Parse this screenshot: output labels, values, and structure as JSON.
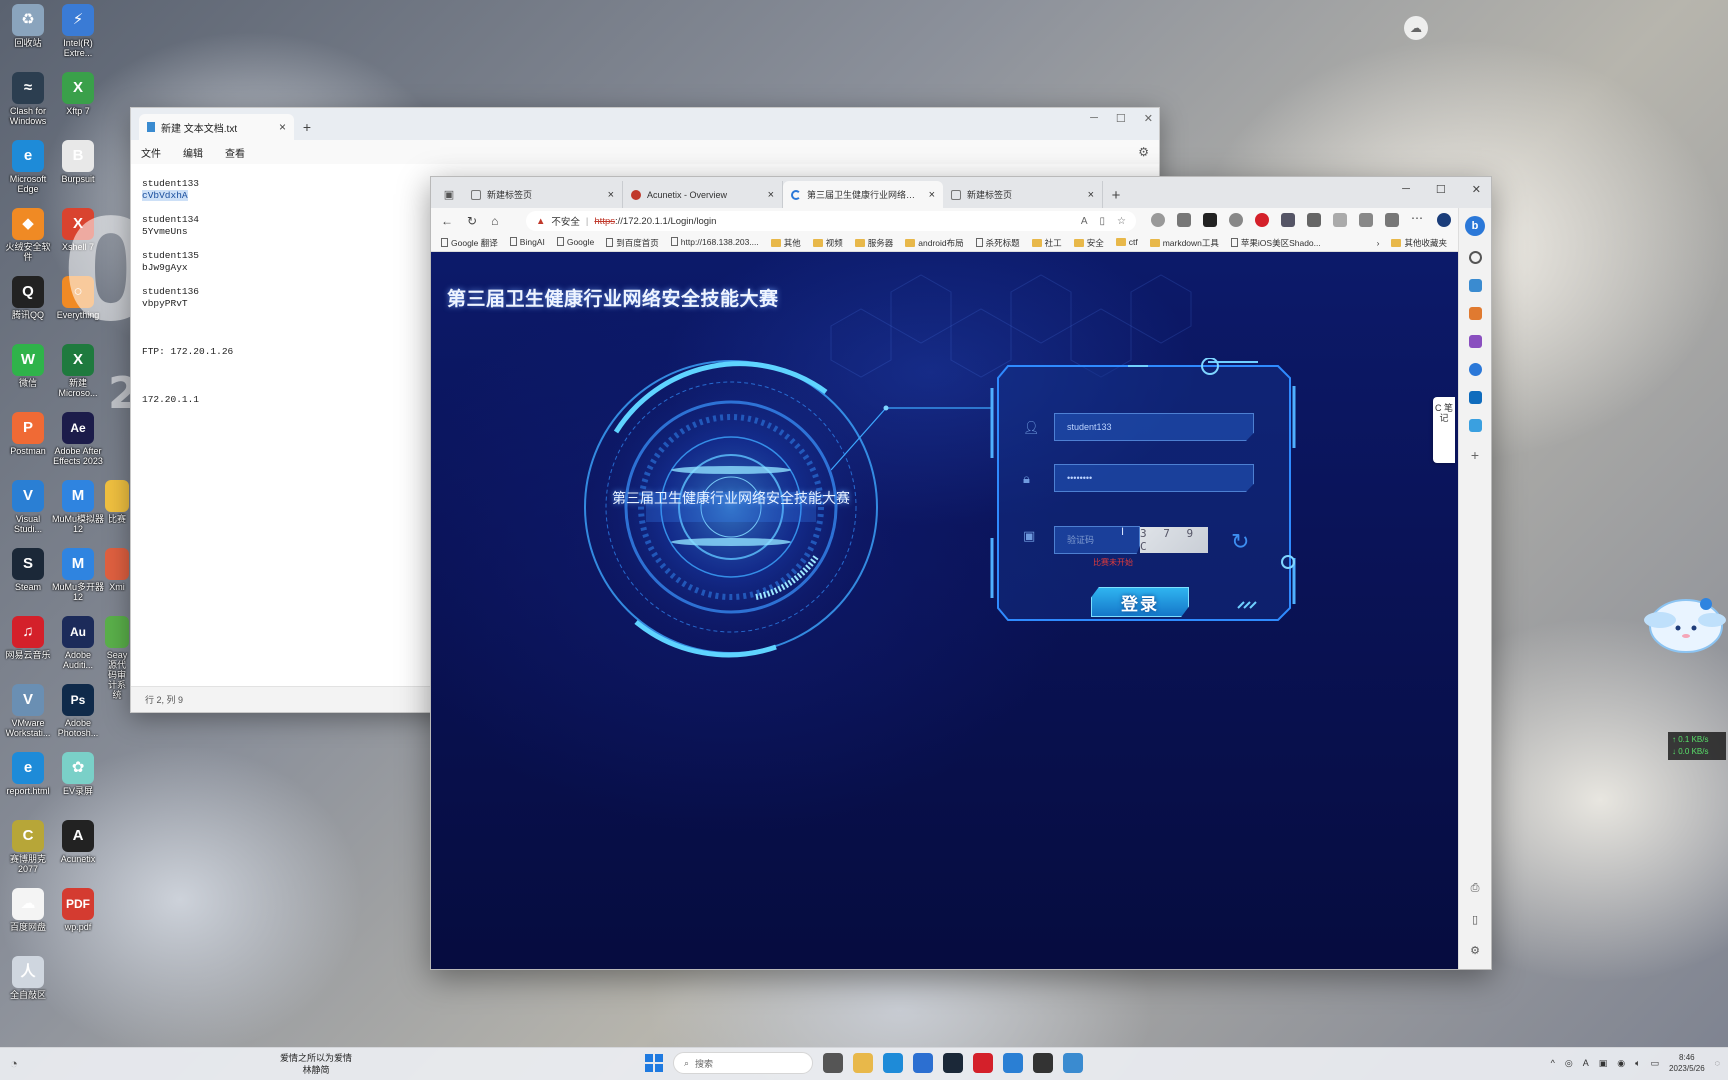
{
  "desktop": {
    "icons": [
      {
        "label": "回收站",
        "color": "#8aa4bd",
        "glyph": "♻"
      },
      {
        "label": "Intel(R) Extre...",
        "color": "#3a7bd5",
        "glyph": "⚡"
      },
      {
        "label": "Clash for Windows",
        "color": "#2c3e50",
        "glyph": "≈"
      },
      {
        "label": "Xftp 7",
        "color": "#3aa04a",
        "glyph": "X"
      },
      {
        "label": "Microsoft Edge",
        "color": "#1e8bd8",
        "glyph": "e"
      },
      {
        "label": "Burpsuit",
        "color": "#e8e8e8",
        "glyph": "B"
      },
      {
        "label": "火绒安全软件",
        "color": "#f08a24",
        "glyph": "◆"
      },
      {
        "label": "Xshell 7",
        "color": "#d9432f",
        "glyph": "X"
      },
      {
        "label": "腾讯QQ",
        "color": "#222",
        "glyph": "Q"
      },
      {
        "label": "Everything",
        "color": "#f08a24",
        "glyph": "○"
      },
      {
        "label": "微信",
        "color": "#2fb34a",
        "glyph": "W"
      },
      {
        "label": "新建 Microso...",
        "color": "#1f7a3e",
        "glyph": "X"
      },
      {
        "label": "Postman",
        "color": "#f06a35",
        "glyph": "P"
      },
      {
        "label": "Adobe After Effects 2023",
        "color": "#1c1c4a",
        "glyph": "Ae"
      },
      {
        "label": "Visual Studi...",
        "color": "#2a7fd4",
        "glyph": "V"
      },
      {
        "label": "MuMu模拟器12",
        "color": "#2f84e0",
        "glyph": "M"
      },
      {
        "label": "Steam",
        "color": "#1b2838",
        "glyph": "S"
      },
      {
        "label": "MuMu多开器12",
        "color": "#2f84e0",
        "glyph": "M"
      },
      {
        "label": "网易云音乐",
        "color": "#d4202a",
        "glyph": "♫"
      },
      {
        "label": "Adobe Auditi...",
        "color": "#1c2b5a",
        "glyph": "Au"
      },
      {
        "label": "VMware Workstati...",
        "color": "#6a8fb3",
        "glyph": "V"
      },
      {
        "label": "Adobe Photosh...",
        "color": "#0f2a4a",
        "glyph": "Ps"
      },
      {
        "label": "report.html",
        "color": "#1e8bd8",
        "glyph": "e"
      },
      {
        "label": "EV录屏",
        "color": "#7ad0c8",
        "glyph": "✿"
      },
      {
        "label": "赛博朋克 2077",
        "color": "#b7a638",
        "glyph": "C"
      },
      {
        "label": "Acunetix",
        "color": "#222",
        "glyph": "A"
      },
      {
        "label": "百度网盘",
        "color": "#f4f4f4",
        "glyph": "☁"
      },
      {
        "label": "wp.pdf",
        "color": "#d43b30",
        "glyph": "PDF"
      },
      {
        "label": "全自敲区",
        "color": "#cfd6df",
        "glyph": "人"
      }
    ],
    "partial_icons": [
      {
        "label": "比赛",
        "color": "#f0c040"
      },
      {
        "label": "Xmi",
        "color": "#e06040"
      },
      {
        "label": "Seay源代码审计系统",
        "color": "#5ab04a"
      }
    ],
    "deco_big_digit": "0",
    "deco_digits": "26"
  },
  "notepad": {
    "tab_title": "新建 文本文档.txt",
    "menu": [
      "文件",
      "编辑",
      "查看"
    ],
    "lines": [
      {
        "user": "student133",
        "pass": "cVbVdxhA",
        "selected": true
      },
      {
        "user": "student134",
        "pass": "5YvmeUns",
        "selected": false
      },
      {
        "user": "student135",
        "pass": "bJw9gAyx",
        "selected": false
      },
      {
        "user": "student136",
        "pass": "vbpyPRvT",
        "selected": false
      }
    ],
    "ftp_line": "FTP: 172.20.1.26",
    "ip_line": "172.20.1.1",
    "status": "行 2, 列 9"
  },
  "browser": {
    "tabs": [
      {
        "label": "新建标签页",
        "icon": "page",
        "active": false
      },
      {
        "label": "Acunetix - Overview",
        "icon": "red",
        "active": false
      },
      {
        "label": "第三届卫生健康行业网络安全技...",
        "icon": "spin",
        "active": true
      },
      {
        "label": "新建标签页",
        "icon": "page",
        "active": false
      }
    ],
    "address": {
      "insecure_label": "不安全",
      "scheme": "https",
      "rest": "://172.20.1.1/Login/login"
    },
    "bookmarks": [
      {
        "label": "Google 翻译",
        "type": "page"
      },
      {
        "label": "BingAI",
        "type": "page"
      },
      {
        "label": "Google",
        "type": "page"
      },
      {
        "label": "到百度首页",
        "type": "page"
      },
      {
        "label": "http://168.138.203....",
        "type": "page"
      },
      {
        "label": "其他",
        "type": "folder"
      },
      {
        "label": "视频",
        "type": "folder"
      },
      {
        "label": "服务器",
        "type": "folder"
      },
      {
        "label": "android布局",
        "type": "folder"
      },
      {
        "label": "杀死标题",
        "type": "page"
      },
      {
        "label": "社工",
        "type": "folder"
      },
      {
        "label": "安全",
        "type": "folder"
      },
      {
        "label": "ctf",
        "type": "folder"
      },
      {
        "label": "markdown工具",
        "type": "folder"
      },
      {
        "label": "苹果iOS美区Shado...",
        "type": "page"
      }
    ],
    "other_bookmarks": "其他收藏夹",
    "note_tab": "C 笔 记"
  },
  "login_page": {
    "title": "第三届卫生健康行业网络安全技能大赛",
    "orb_text": "第三届卫生健康行业网络安全技能大赛",
    "username_value": "student133",
    "password_value": "••••••••",
    "captcha_placeholder": "验证码",
    "captcha_text": "3 7 9 C",
    "status_message": "比赛未开始",
    "login_button": "登录"
  },
  "overlays": {
    "net_up": "↑ 0.1 KB/s",
    "net_down": "↓ 0.0 KB/s"
  },
  "taskbar": {
    "song_line1": "爱情之所以为爱情",
    "song_line2": "林静简",
    "search_placeholder": "搜索",
    "apps": [
      {
        "name": "task-view",
        "color": "#555"
      },
      {
        "name": "explorer",
        "color": "#e8b84a"
      },
      {
        "name": "edge",
        "color": "#1e8bd8"
      },
      {
        "name": "store",
        "color": "#2c6fd1"
      },
      {
        "name": "cat-app",
        "color": "#1b2838"
      },
      {
        "name": "netease-music",
        "color": "#d4202a"
      },
      {
        "name": "vscode",
        "color": "#2a7fd4"
      },
      {
        "name": "terminal",
        "color": "#333"
      },
      {
        "name": "notepad",
        "color": "#3a8bd0"
      }
    ],
    "time": "8:46",
    "date": "2023/5/26"
  },
  "colors": {
    "page_bg": "#0a1358",
    "accent": "#2fb4f0",
    "error": "#e03b3b"
  }
}
